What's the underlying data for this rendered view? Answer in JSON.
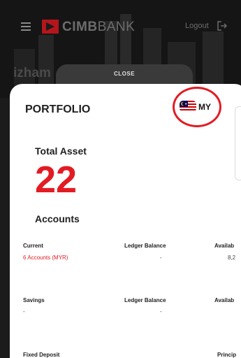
{
  "header": {
    "brand": "CIMB",
    "brand_suffix": "BANK",
    "logout_label": "Logout"
  },
  "user": {
    "name": "izham"
  },
  "sheet": {
    "close_label": "CLOSE"
  },
  "portfolio": {
    "title": "PORTFOLIO",
    "country_code": "MY",
    "total_asset_label": "Total Asset",
    "total_asset_count": "22",
    "accounts_label": "Accounts"
  },
  "sections": {
    "current": {
      "title": "Current",
      "ledger_header": "Ledger Balance",
      "available_header": "Availab",
      "link_text": "6 Accounts (MYR)",
      "ledger_value": "-",
      "available_value": "8,2"
    },
    "savings": {
      "title": "Savings",
      "ledger_header": "Ledger Balance",
      "available_header": "Availab",
      "left_value": "-",
      "ledger_value": "-"
    },
    "fixed_deposit": {
      "title": "Fixed Deposit",
      "principal_header": "Princip"
    }
  },
  "colors": {
    "accent_red": "#e31b23",
    "dark_bg": "#1b1b1b",
    "text_dark": "#1f1f1f"
  },
  "icons": {
    "menu": "hamburger-icon",
    "logo": "cimb-logo-icon",
    "logout": "logout-icon",
    "flag": "malaysia-flag-icon"
  }
}
